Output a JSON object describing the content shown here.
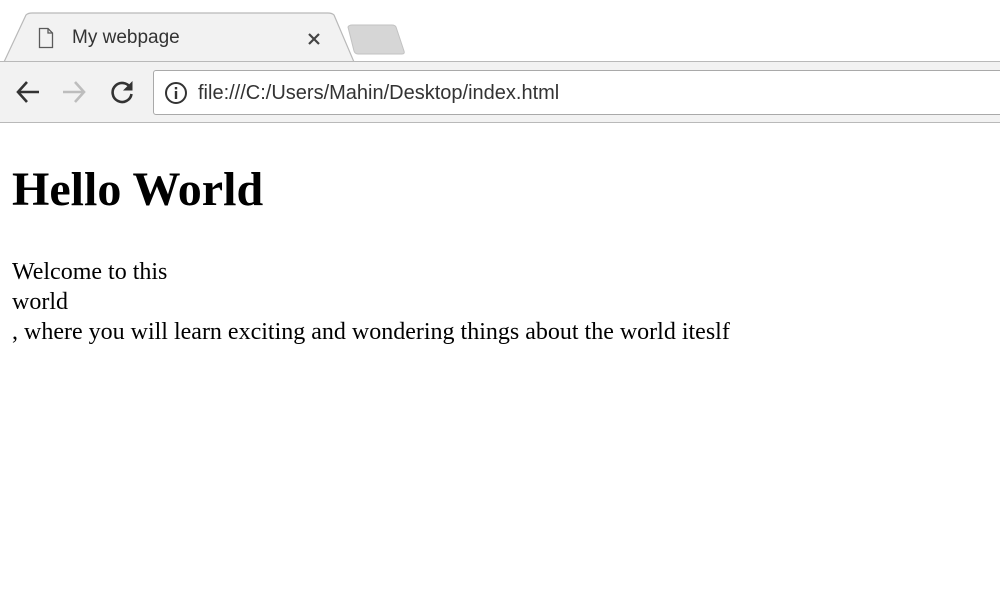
{
  "tab": {
    "title": "My webpage",
    "icon": "document-icon",
    "close_icon": "close-icon"
  },
  "toolbar": {
    "back_icon": "back-arrow-icon",
    "forward_icon": "forward-arrow-icon",
    "reload_icon": "reload-icon"
  },
  "address_bar": {
    "icon": "info-icon",
    "url": "file:///C:/Users/Mahin/Desktop/index.html"
  },
  "content": {
    "heading": "Hello World",
    "lines": [
      "Welcome to this",
      "world",
      ", where you will learn exciting and wondering things about the world iteslf"
    ]
  },
  "colors": {
    "tab_active": "#f2f2f2",
    "tab_inactive": "#d6d6d6",
    "toolbar": "#f2f2f2",
    "border": "#b9b9b9"
  }
}
